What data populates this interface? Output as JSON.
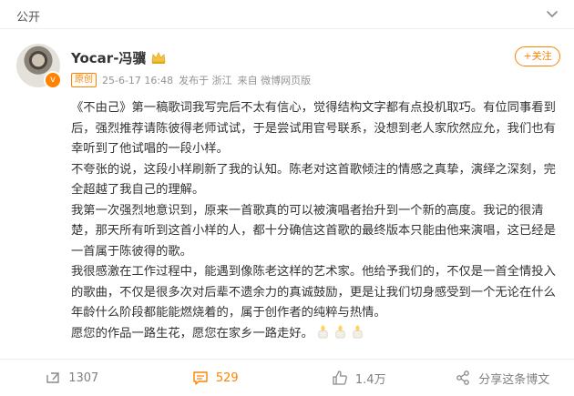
{
  "header": {
    "visibility_label": "公开"
  },
  "post": {
    "author": {
      "name": "Yocar-冯骥",
      "verified_badge": "v"
    },
    "meta": {
      "tag": "原创",
      "time": "25-6-17 16:48",
      "location": "发布于 浙江",
      "source": "来自 微博网页版"
    },
    "follow_label": "+关注",
    "paragraphs": [
      "《不由己》第一稿歌词我写完后不太有信心，觉得结构文字都有点投机取巧。有位同事看到后，强烈推荐请陈彼得老师试试，于是尝试用官号联系，没想到老人家欣然应允，我们也有幸听到了他试唱的一段小样。",
      "不夸张的说，这段小样刷新了我的认知。陈老对这首歌倾注的情感之真挚，演绎之深刻，完全超越了我自己的理解。",
      "我第一次强烈地意识到，原来一首歌真的可以被演唱者抬升到一个新的高度。我记的很清楚，那天所有听到这首小样的人，都十分确信这首歌的最终版本只能由他来演唱，这已经是一首属于陈彼得的歌。",
      "我很感激在工作过程中，能遇到像陈老这样的艺术家。他给予我们的，不仅是一首全情投入的歌曲，不仅是很多次对后辈不遗余力的真诚鼓励，更是让我们切身感受到一个无论在什么年龄什么阶段都能能燃烧着的，属于创作者的纯粹与热情。",
      "愿您的作品一路生花，愿您在家乡一路走好。"
    ],
    "emojis": [
      "candle-icon",
      "candle-icon",
      "candle-icon"
    ]
  },
  "actions": {
    "repost_count": "1307",
    "comment_count": "529",
    "like_count": "1.4万",
    "share_label": "分享这条博文"
  },
  "colors": {
    "accent": "#ff8200",
    "text": "#333333",
    "muted": "#939393"
  }
}
